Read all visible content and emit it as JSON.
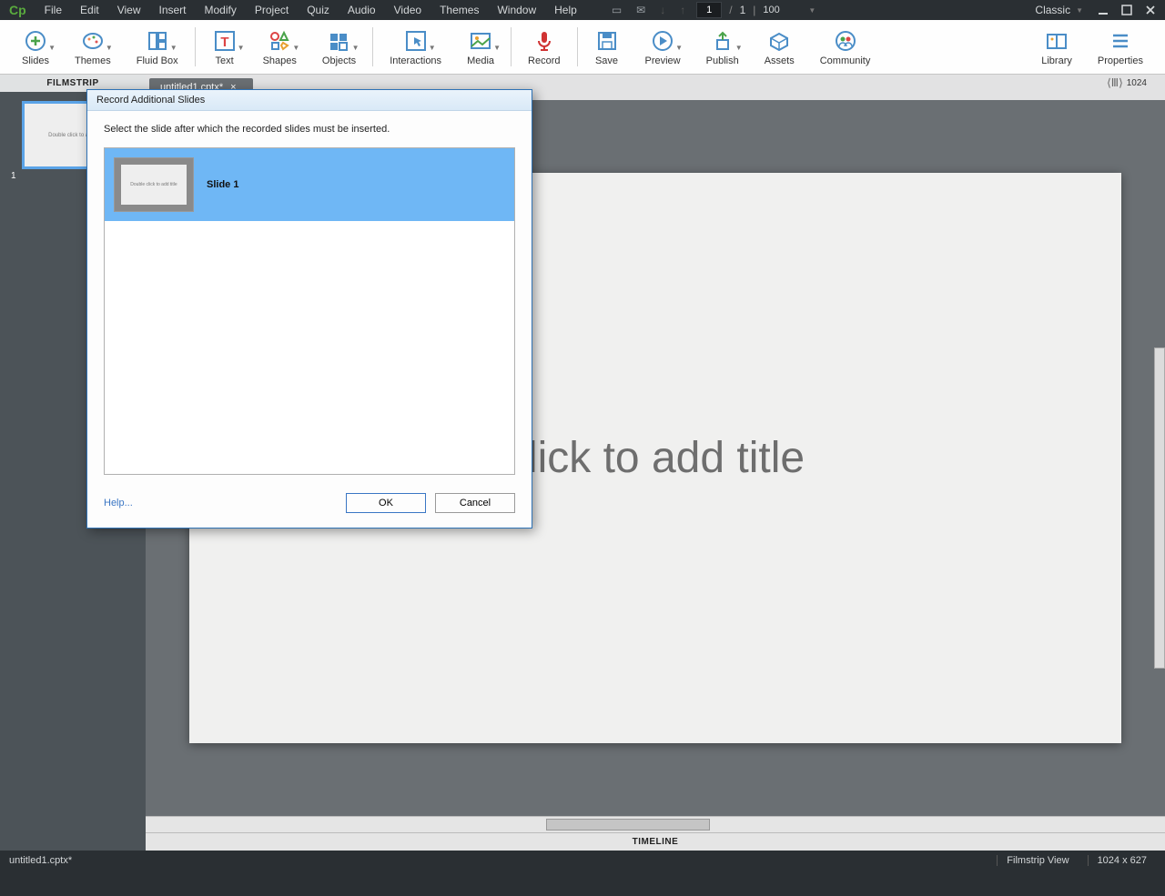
{
  "app": {
    "logo": "Cp"
  },
  "menubar": [
    "File",
    "Edit",
    "View",
    "Insert",
    "Modify",
    "Project",
    "Quiz",
    "Audio",
    "Video",
    "Themes",
    "Window",
    "Help"
  ],
  "topcontrols": {
    "page_current": "1",
    "page_sep": "/",
    "page_total": "1",
    "zoom": "100",
    "workspace": "Classic"
  },
  "ribbon": [
    {
      "key": "slides",
      "label": "Slides",
      "dd": true,
      "sep": false
    },
    {
      "key": "themes",
      "label": "Themes",
      "dd": true,
      "sep": false
    },
    {
      "key": "fluidbox",
      "label": "Fluid Box",
      "dd": true,
      "sep": true
    },
    {
      "key": "text",
      "label": "Text",
      "dd": true,
      "sep": false
    },
    {
      "key": "shapes",
      "label": "Shapes",
      "dd": true,
      "sep": false
    },
    {
      "key": "objects",
      "label": "Objects",
      "dd": true,
      "sep": true
    },
    {
      "key": "interactions",
      "label": "Interactions",
      "dd": true,
      "sep": false
    },
    {
      "key": "media",
      "label": "Media",
      "dd": true,
      "sep": true
    },
    {
      "key": "record",
      "label": "Record",
      "dd": false,
      "sep": true
    },
    {
      "key": "save",
      "label": "Save",
      "dd": false,
      "sep": false
    },
    {
      "key": "preview",
      "label": "Preview",
      "dd": true,
      "sep": false
    },
    {
      "key": "publish",
      "label": "Publish",
      "dd": true,
      "sep": false
    },
    {
      "key": "assets",
      "label": "Assets",
      "dd": false,
      "sep": false
    },
    {
      "key": "community",
      "label": "Community",
      "dd": false,
      "sep": false
    }
  ],
  "ribbon_right": [
    {
      "key": "library",
      "label": "Library"
    },
    {
      "key": "properties",
      "label": "Properties"
    }
  ],
  "filmstrip": {
    "header": "FILMSTRIP",
    "items": [
      {
        "num": "1",
        "thumb_text": "Double click to add title"
      }
    ]
  },
  "canvas": {
    "title_placeholder": "click to add title",
    "width_label": "1024"
  },
  "timeline": {
    "label": "TIMELINE"
  },
  "statusbar": {
    "file": "untitled1.cptx*",
    "view": "Filmstrip View",
    "dims": "1024 x 627"
  },
  "dialog": {
    "title": "Record Additional Slides",
    "instruction": "Select the slide after which the recorded slides must be inserted.",
    "items": [
      {
        "label": "Slide 1",
        "thumb_text": "Double click to add title"
      }
    ],
    "help": "Help...",
    "ok": "OK",
    "cancel": "Cancel"
  }
}
